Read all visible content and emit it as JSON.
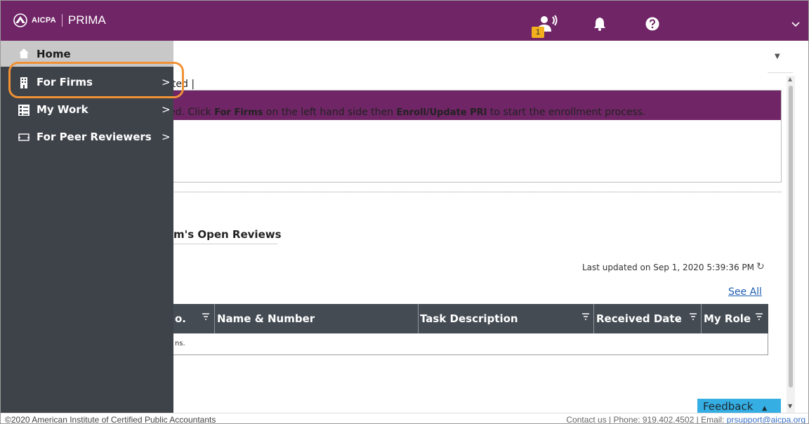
{
  "header": {
    "logo_org": "AICPA",
    "logo_app": "PRIMA",
    "tasks_badge_count": "1",
    "icons": [
      "tasks-icon",
      "bell-icon",
      "help-icon",
      "chevron-down-icon"
    ],
    "brand_color": "#702566"
  },
  "sidebar": {
    "items": [
      {
        "label": "Home",
        "icon": "home-icon",
        "selected": true
      },
      {
        "label": "For Firms",
        "icon": "building-icon",
        "highlighted": true
      },
      {
        "label": "My Work",
        "icon": "worklist-icon"
      },
      {
        "label": "For Peer Reviewers",
        "icon": "monitor-icon"
      }
    ],
    "chevron": ">"
  },
  "notice": {
    "title_visible": "ited |",
    "body_prefix": "ed. Click ",
    "body_bold_1": "For Firms",
    "body_mid": " on the left hand side then ",
    "body_bold_2": "Enroll/Update PRI",
    "body_suffix": " to start the enrollment process."
  },
  "reviews": {
    "title_visible": "m's Open Reviews",
    "last_updated": "Last updated on Sep 1, 2020 5:39:36 PM",
    "see_all": "See All",
    "columns": [
      "o.",
      "Name & Number",
      "Task Description",
      "Received Date",
      "My Role"
    ],
    "sort_indicator": "⌄",
    "empty_text_visible": "ns."
  },
  "feedback": {
    "label": "Feedback"
  },
  "footer": {
    "copyright": "©2020 American Institute of Certified Public Accountants",
    "contact_prefix": "Contact us | Phone: 919.402.4502 | Email: ",
    "email": "prsupport@aicpa.org"
  }
}
